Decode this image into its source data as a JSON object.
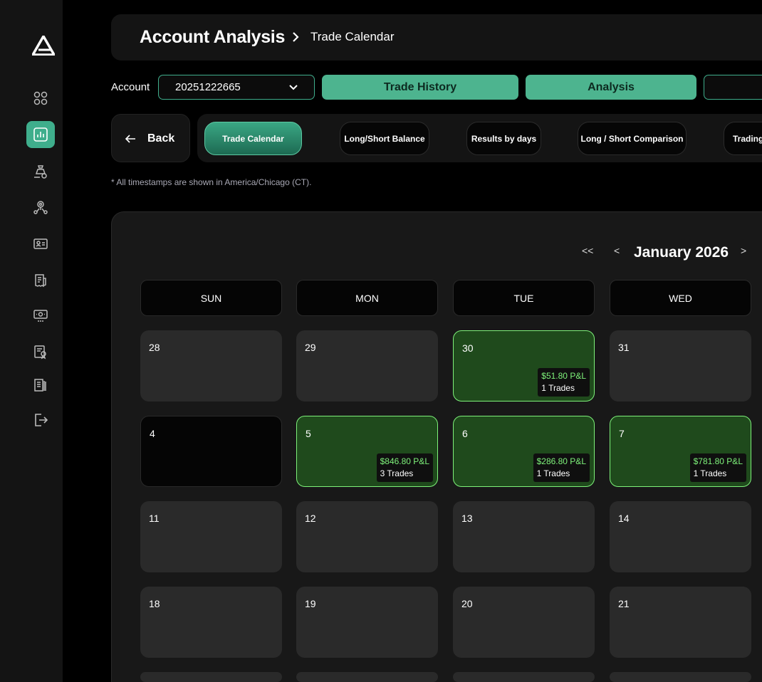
{
  "header": {
    "title": "Account Analysis",
    "breadcrumb": "Trade Calendar"
  },
  "account": {
    "label": "Account",
    "selected": "20251222665"
  },
  "actions": {
    "trade_history": "Trade History",
    "analysis": "Analysis"
  },
  "back_label": "Back",
  "tabs": [
    {
      "label": "Trade Calendar"
    },
    {
      "label": "Long/Short Balance"
    },
    {
      "label": "Results by days"
    },
    {
      "label": "Long / Short Comparison"
    },
    {
      "label": "Trading"
    }
  ],
  "timezone_note": "* All timestamps are shown in America/Chicago (CT).",
  "calendar": {
    "nav_first": "<<",
    "nav_prev": "<",
    "nav_next": ">",
    "month": "January 2026",
    "weekdays": [
      "SUN",
      "MON",
      "TUE",
      "WED"
    ],
    "days": [
      {
        "n": "28"
      },
      {
        "n": "29"
      },
      {
        "n": "30",
        "pnl": "$51.80 P&L",
        "trades": "1 Trades"
      },
      {
        "n": "31"
      },
      {
        "n": "4"
      },
      {
        "n": "5",
        "pnl": "$846.80 P&L",
        "trades": "3 Trades"
      },
      {
        "n": "6",
        "pnl": "$286.80 P&L",
        "trades": "1 Trades"
      },
      {
        "n": "7",
        "pnl": "$781.80 P&L",
        "trades": "1 Trades"
      },
      {
        "n": "11"
      },
      {
        "n": "12"
      },
      {
        "n": "13"
      },
      {
        "n": "14"
      },
      {
        "n": "18"
      },
      {
        "n": "19"
      },
      {
        "n": "20"
      },
      {
        "n": "21"
      }
    ]
  },
  "colors": {
    "accent": "#4db48f",
    "profit": "#7ef27a",
    "trade_cell": "#1f4a1c"
  },
  "icons": [
    "dashboard-icon",
    "analysis-icon",
    "payouts-icon",
    "affiliate-icon",
    "profile-icon",
    "rules-icon",
    "certificates-icon",
    "awards-icon",
    "docs-icon",
    "logout-icon"
  ]
}
